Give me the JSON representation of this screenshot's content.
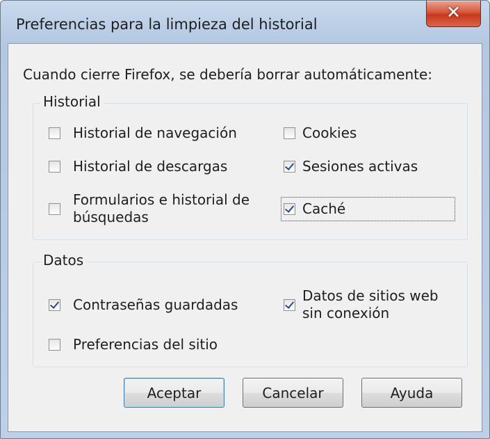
{
  "window": {
    "title": "Preferencias para la limpieza del historial",
    "close_glyph": "✕"
  },
  "intro": "Cuando cierre Firefox, se debería borrar automáticamente:",
  "historial": {
    "legend": "Historial",
    "items": [
      {
        "label": "Historial de navegación",
        "checked": false
      },
      {
        "label": "Historial de descargas",
        "checked": false
      },
      {
        "label": "Formularios e historial de búsquedas",
        "checked": false
      },
      {
        "label": "Cookies",
        "checked": false
      },
      {
        "label": "Sesiones activas",
        "checked": true
      },
      {
        "label": "Caché",
        "checked": true
      }
    ]
  },
  "datos": {
    "legend": "Datos",
    "items": [
      {
        "label": "Contraseñas guardadas",
        "checked": true
      },
      {
        "label": "Preferencias del sitio",
        "checked": false
      },
      {
        "label": "Datos de sitios web sin conexión",
        "checked": true
      }
    ]
  },
  "buttons": {
    "accept": "Aceptar",
    "cancel": "Cancelar",
    "help": "Ayuda"
  }
}
